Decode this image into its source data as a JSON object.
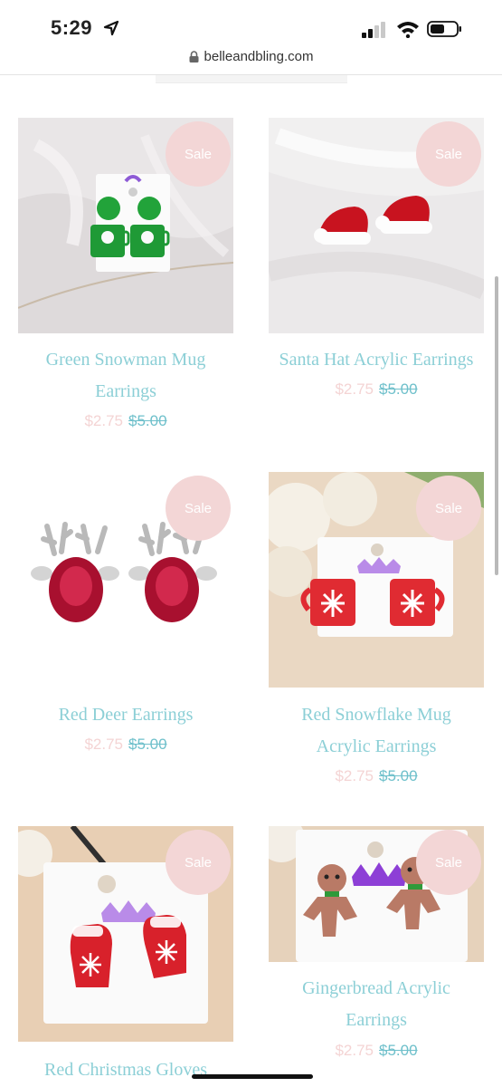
{
  "status_bar": {
    "time": "5:29"
  },
  "browser": {
    "url": "belleandbling.com"
  },
  "products": [
    {
      "title_line1": "Green Snowman Mug",
      "title_line2": "Earrings",
      "badge": "Sale",
      "price_sale": "$2.75",
      "price_original": "$5.00"
    },
    {
      "title_line1": "Santa Hat Acrylic Earrings",
      "title_line2": "",
      "badge": "Sale",
      "price_sale": "$2.75",
      "price_original": "$5.00"
    },
    {
      "title_line1": "Red Deer Earrings",
      "title_line2": "",
      "badge": "Sale",
      "price_sale": "$2.75",
      "price_original": "$5.00"
    },
    {
      "title_line1": "Red Snowflake Mug",
      "title_line2": "Acrylic Earrings",
      "badge": "Sale",
      "price_sale": "$2.75",
      "price_original": "$5.00"
    },
    {
      "title_line1": "Red Christmas Gloves",
      "title_line2": "",
      "badge": "Sale",
      "price_sale": "",
      "price_original": ""
    },
    {
      "title_line1": "Gingerbread Acrylic",
      "title_line2": "Earrings",
      "badge": "Sale",
      "price_sale": "$2.75",
      "price_original": "$5.00"
    }
  ],
  "colors": {
    "title": "#8ccfd6",
    "sale_badge": "#f3d6d6",
    "price_sale": "#f4d4d4",
    "price_original": "#6fc0cb"
  }
}
